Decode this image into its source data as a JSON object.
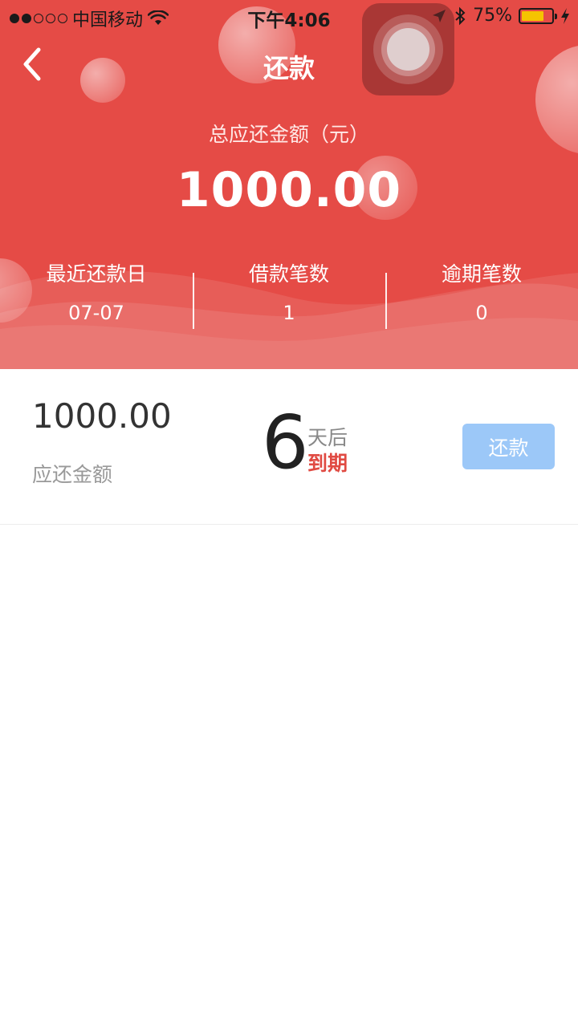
{
  "status_bar": {
    "carrier": "中国移动",
    "time": "下午4:06",
    "battery_percent": "75%",
    "battery_level": 0.75,
    "signal_strength": 2,
    "icons": [
      "wifi-icon",
      "location-arrow-icon",
      "bluetooth-icon",
      "charging-bolt-icon"
    ]
  },
  "nav": {
    "title": "还款",
    "back_icon": "chevron-left-icon"
  },
  "summary": {
    "total_label": "总应还金额（元）",
    "total_amount": "1000.00",
    "stats": [
      {
        "label": "最近还款日",
        "value": "07-07"
      },
      {
        "label": "借款笔数",
        "value": "1"
      },
      {
        "label": "逾期笔数",
        "value": "0"
      }
    ]
  },
  "loans": [
    {
      "amount": "1000.00",
      "amount_label": "应还金额",
      "days": "6",
      "days_suffix": "天后",
      "due_label": "到期",
      "button_label": "还款"
    }
  ],
  "colors": {
    "header_red": "#e54b46",
    "button_blue": "#9cc8f8",
    "due_red": "#e04a42",
    "battery_yellow": "#f5c300"
  }
}
